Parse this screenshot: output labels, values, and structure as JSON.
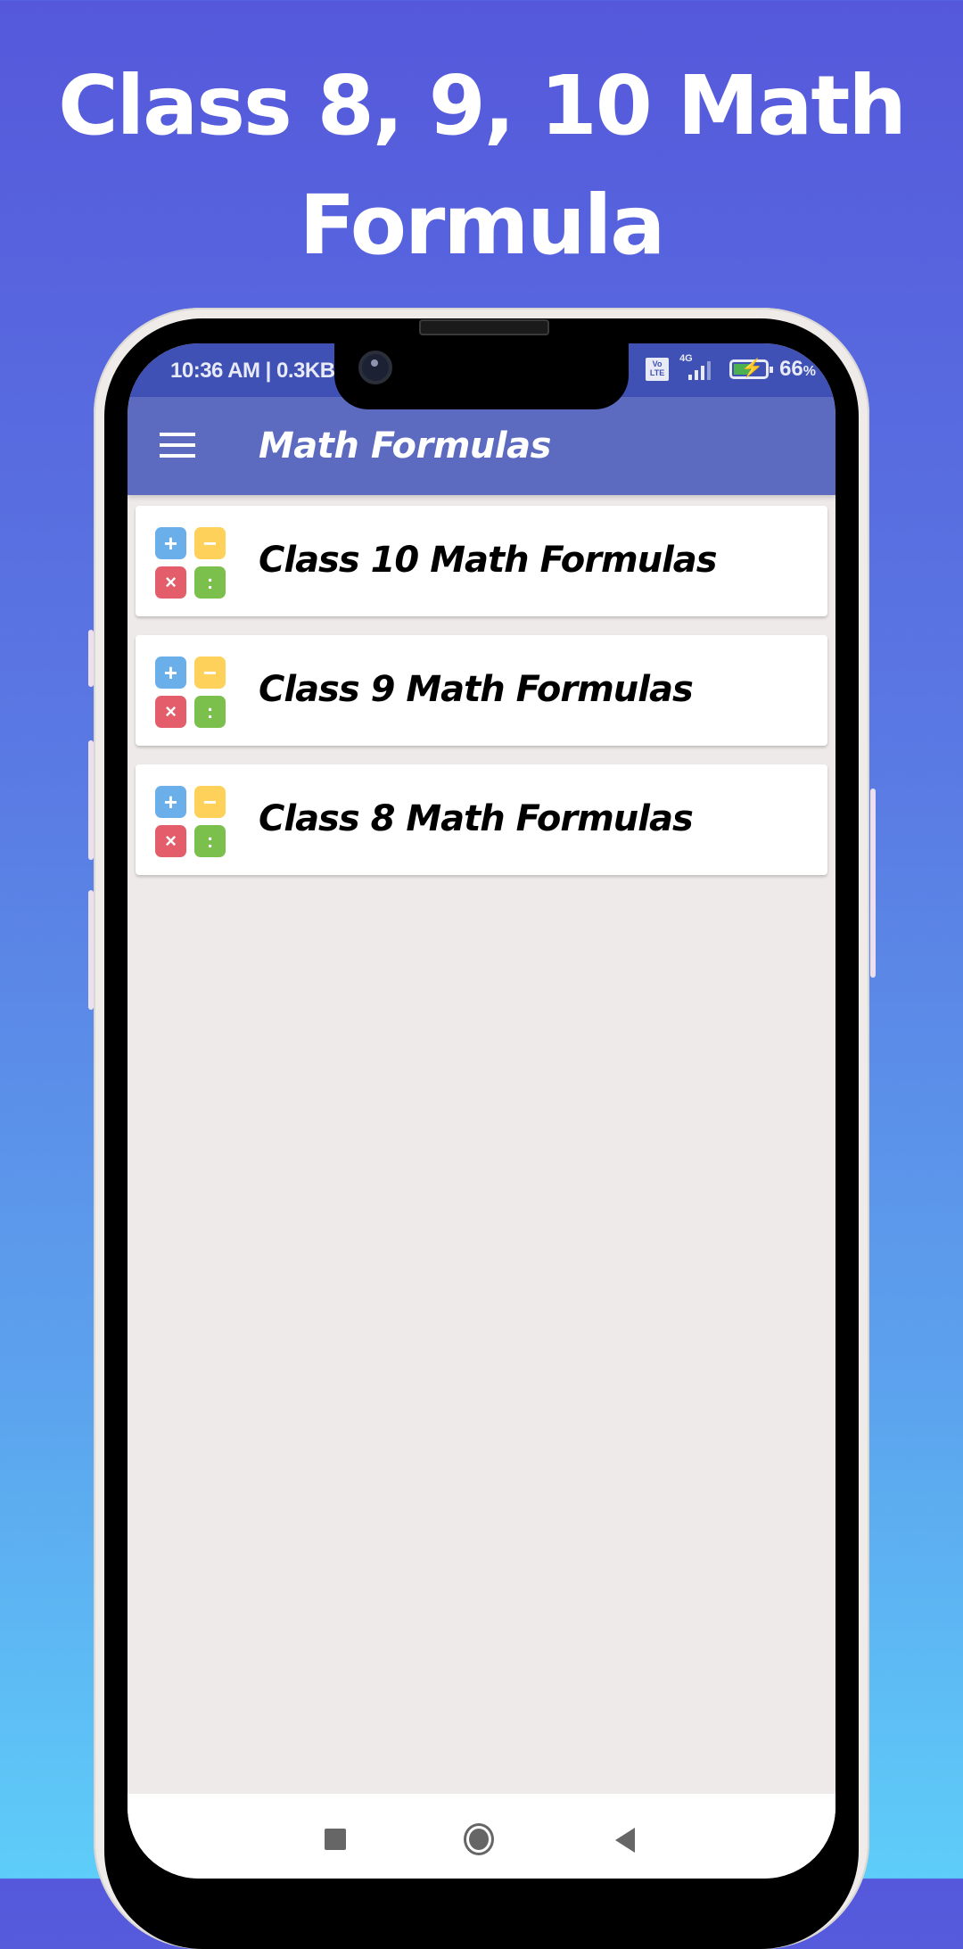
{
  "promo": {
    "title_line1": "Class 8, 9, 10 Math",
    "title_line2": "Formula"
  },
  "status_bar": {
    "time_and_speed": "10:36 AM | 0.3KB",
    "volte_label": "Vo LTE",
    "network_label": "4G",
    "battery_percent": "66",
    "battery_percent_sign": "%",
    "battery_charging": true
  },
  "app_bar": {
    "menu_icon": "hamburger-menu-icon",
    "title": "Math Formulas"
  },
  "list": {
    "items": [
      {
        "label": "Class 10 Math Formulas",
        "icon": "calculator-icon"
      },
      {
        "label": "Class 9 Math Formulas",
        "icon": "calculator-icon"
      },
      {
        "label": "Class 8 Math Formulas",
        "icon": "calculator-icon"
      }
    ],
    "icon_glyphs": {
      "plus": "+",
      "minus": "−",
      "times": "×",
      "divide": ":"
    }
  },
  "system_nav": {
    "recents": "recents-icon",
    "home": "home-icon",
    "back": "back-icon"
  },
  "colors": {
    "status_bar": "#3f51b5",
    "app_bar": "#5c6bc0",
    "content_bg": "#efeaea",
    "card_bg": "#ffffff",
    "key_plus": "#6aaeea",
    "key_minus": "#fdd15a",
    "key_times": "#e35d6a",
    "key_divide": "#7bbf4c"
  }
}
